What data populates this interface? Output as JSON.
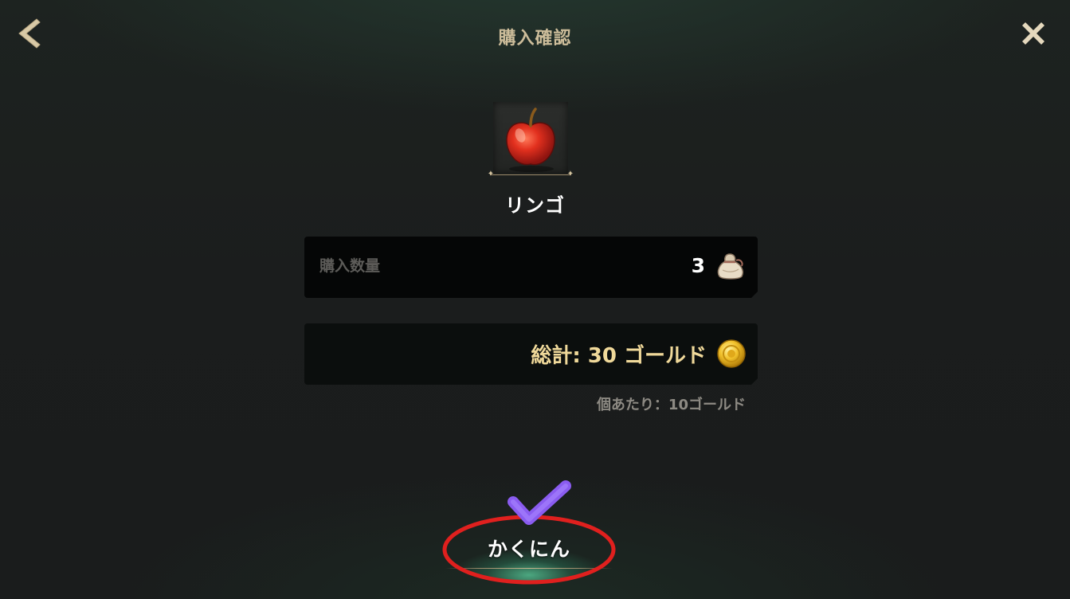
{
  "header": {
    "title": "購入確認",
    "back_icon": "chevron-left-icon",
    "close_icon": "close-icon"
  },
  "item": {
    "name": "リンゴ",
    "icon": "apple-icon"
  },
  "quantity": {
    "label": "購入数量",
    "value": "3",
    "icon": "bag-icon"
  },
  "total": {
    "text": "総計: 30 ゴールド",
    "icon": "gold-coin-icon"
  },
  "unit_price": {
    "text": "個あたり：10ゴールド"
  },
  "confirm": {
    "label": "かくにん"
  },
  "colors": {
    "accent_gold": "#cdbd9a",
    "total_text": "#f0d99a",
    "annotation_check": "#8a5cf0",
    "annotation_circle": "#e0201e",
    "confirm_glow": "#5cd2a0"
  }
}
